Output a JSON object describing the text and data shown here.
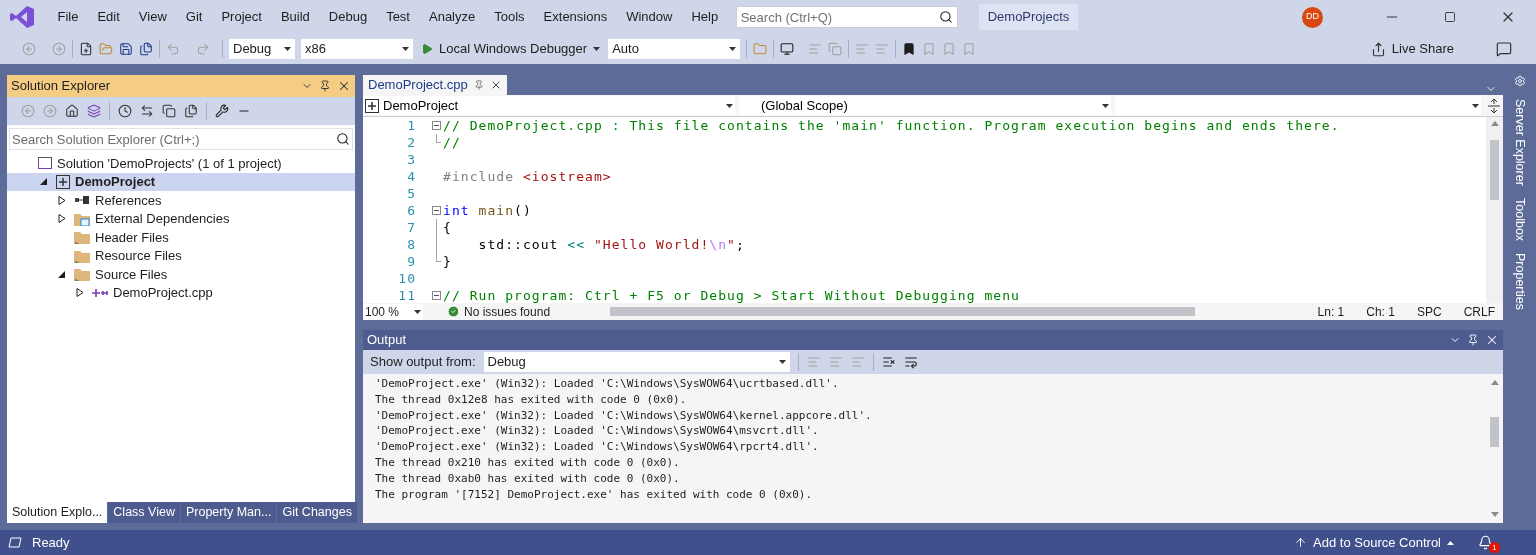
{
  "menu_bar": {
    "items": [
      "File",
      "Edit",
      "View",
      "Git",
      "Project",
      "Build",
      "Debug",
      "Test",
      "Analyze",
      "Tools",
      "Extensions",
      "Window",
      "Help"
    ],
    "search": {
      "placeholder": "Search (Ctrl+Q)"
    },
    "solution_name": "DemoProjects",
    "avatar": "DD"
  },
  "toolbar": {
    "configuration": "Debug",
    "platform": "x86",
    "debugger": "Local Windows Debugger",
    "stack_frame": "Auto",
    "live_share": "Live Share"
  },
  "solution_explorer": {
    "title": "Solution Explorer",
    "search": {
      "placeholder": "Search Solution Explorer (Ctrl+;)"
    },
    "tree": [
      {
        "label": "Solution 'DemoProjects' (1 of 1 project)",
        "kind": "solution",
        "selected": false,
        "children": [
          {
            "label": "DemoProject",
            "kind": "project",
            "selected": true,
            "startup": true,
            "expanded": true,
            "children": [
              {
                "label": "References",
                "kind": "references",
                "selected": false,
                "expanded": false
              },
              {
                "label": "External Dependencies",
                "kind": "external",
                "selected": false,
                "expanded": false
              },
              {
                "label": "Header Files",
                "kind": "folder",
                "selected": false
              },
              {
                "label": "Resource Files",
                "kind": "folder",
                "selected": false
              },
              {
                "label": "Source Files",
                "kind": "folder",
                "selected": false,
                "expanded": true,
                "children": [
                  {
                    "label": "DemoProject.cpp",
                    "kind": "cpp",
                    "selected": false,
                    "expanded": false
                  }
                ]
              }
            ]
          }
        ]
      }
    ],
    "tabs": [
      {
        "label": "Solution Explo...",
        "selected": true
      },
      {
        "label": "Class View",
        "selected": false
      },
      {
        "label": "Property Man...",
        "selected": false
      },
      {
        "label": "Git Changes",
        "selected": false
      }
    ]
  },
  "editor": {
    "tab": {
      "label": "DemoProject.cpp"
    },
    "nav": {
      "project": "DemoProject",
      "scope": "(Global Scope)"
    },
    "lines": [
      {
        "number": "1",
        "kind": "fold_start",
        "tokens": [
          {
            "kind": "comment",
            "t": "// DemoProject.cpp : This file contains the 'main' function. Program execution begins and ends there."
          }
        ]
      },
      {
        "number": "2",
        "kind": "fold_end",
        "tokens": [
          {
            "kind": "comment",
            "t": "//"
          }
        ]
      },
      {
        "number": "3"
      },
      {
        "number": "4",
        "tokens": [
          {
            "kind": "preproc",
            "t": "#include "
          },
          {
            "kind": "string",
            "t": "<iostream>"
          }
        ]
      },
      {
        "number": "5"
      },
      {
        "number": "6",
        "kind": "fold_start",
        "tokens": [
          {
            "kind": "keyword",
            "t": "int "
          },
          {
            "kind": "function",
            "t": "main"
          },
          {
            "kind": "plain",
            "t": "()"
          }
        ]
      },
      {
        "number": "7",
        "kind": "fold_mid",
        "tokens": [
          {
            "kind": "plain",
            "t": "{"
          }
        ]
      },
      {
        "number": "8",
        "kind": "fold_mid",
        "tokens": [
          {
            "kind": "plain",
            "t": "    std::cout "
          },
          {
            "kind": "operator",
            "t": "<< "
          },
          {
            "kind": "string",
            "t": "\"Hello World!"
          },
          {
            "kind": "escape",
            "t": "\\n"
          },
          {
            "kind": "string",
            "t": "\""
          },
          {
            "kind": "plain",
            "t": ";"
          }
        ]
      },
      {
        "number": "9",
        "kind": "fold_end",
        "tokens": [
          {
            "kind": "plain",
            "t": "}"
          }
        ]
      },
      {
        "number": "10"
      },
      {
        "number": "11",
        "kind": "fold_start",
        "tokens": [
          {
            "kind": "comment",
            "t": "// Run program: Ctrl + F5 or Debug > Start Without Debugging menu"
          }
        ]
      }
    ],
    "status": {
      "zoom": "100 %",
      "issues": "No issues found",
      "line": "Ln: 1",
      "column": "Ch: 1",
      "indent": "SPC",
      "line_ending": "CRLF"
    }
  },
  "side_tabs": [
    "Server Explorer",
    "Toolbox",
    "Properties"
  ],
  "output": {
    "title": "Output",
    "source_label": "Show output from:",
    "source": "Debug",
    "lines": [
      "'DemoProject.exe' (Win32): Loaded 'C:\\Windows\\SysWOW64\\ucrtbased.dll'.",
      "The thread 0x12e8 has exited with code 0 (0x0).",
      "'DemoProject.exe' (Win32): Loaded 'C:\\Windows\\SysWOW64\\kernel.appcore.dll'.",
      "'DemoProject.exe' (Win32): Loaded 'C:\\Windows\\SysWOW64\\msvcrt.dll'.",
      "'DemoProject.exe' (Win32): Loaded 'C:\\Windows\\SysWOW64\\rpcrt4.dll'.",
      "The thread 0x210 has exited with code 0 (0x0).",
      "The thread 0xab0 has exited with code 0 (0x0).",
      "The program '[7152] DemoProject.exe' has exited with code 0 (0x0)."
    ]
  },
  "status_bar": {
    "text": "Ready",
    "source_control": "Add to Source Control",
    "notifications": "1"
  }
}
